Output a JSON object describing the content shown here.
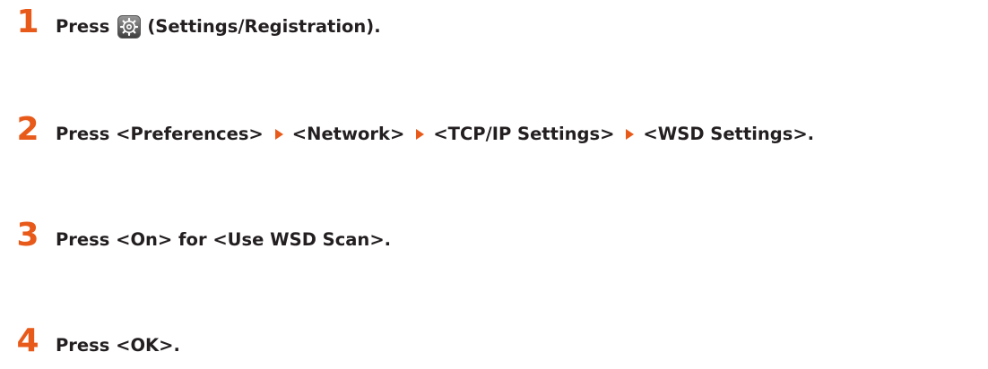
{
  "steps": [
    {
      "number": "1",
      "press": "Press",
      "icon": "settings-registration-icon",
      "after_icon": "(Settings/Registration)."
    },
    {
      "number": "2",
      "press": "Press <Preferences>",
      "path": [
        "<Network>",
        "<TCP/IP Settings>",
        "<WSD Settings>."
      ]
    },
    {
      "number": "3",
      "text": "Press <On> for <Use WSD Scan>."
    },
    {
      "number": "4",
      "text": "Press <OK>."
    }
  ],
  "colors": {
    "accent": "#e85a1a",
    "text": "#231f20"
  }
}
